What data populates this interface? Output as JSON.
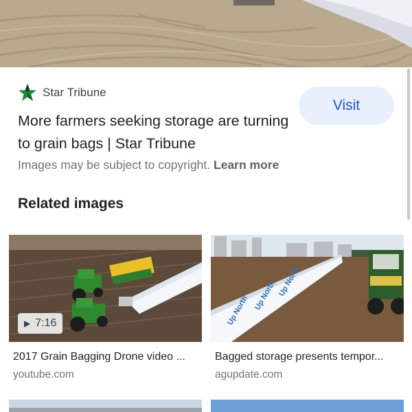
{
  "source": {
    "name": "Star Tribune",
    "icon": "star-icon",
    "accent_colors": [
      "#1a8a3a",
      "#0b3d1f"
    ]
  },
  "visit_button": {
    "label": "Visit"
  },
  "title": "More farmers seeking storage are turning to grain bags | Star Tribune",
  "copyright": {
    "text": "Images may be subject to copyright.",
    "link": "Learn more"
  },
  "related": {
    "heading": "Related images",
    "items": [
      {
        "title": "2017 Grain Bagging Drone video ...",
        "domain": "youtube.com",
        "badge": "7:16",
        "badge_icon": "play-icon"
      },
      {
        "title": "Bagged storage presents tempor...",
        "domain": "agupdate.com"
      }
    ]
  },
  "colors": {
    "visit_bg": "#e8f0fe",
    "visit_text": "#1a56c9",
    "secondary_text": "#70757a"
  }
}
